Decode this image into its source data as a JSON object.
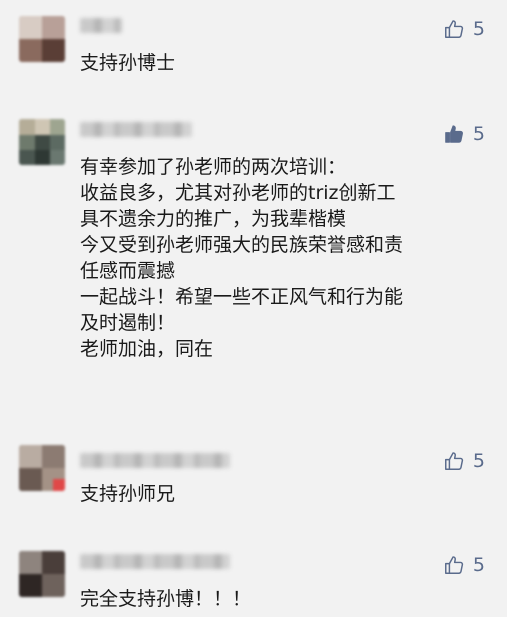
{
  "comments": [
    {
      "author": "",
      "text": "支持孙博士",
      "likes": "5",
      "liked": false
    },
    {
      "author": "",
      "text_lines": [
        "有幸参加了孙老师的两次培训：",
        "收益良多，尤其对孙老师的triz创新工",
        "具不遗余力的推广，为我辈楷模",
        "今又受到孙老师强大的民族荣誉感和责",
        "任感而震撼",
        "一起战斗！希望一些不正风气和行为能",
        "及时遏制！",
        "老师加油，同在"
      ],
      "likes": "5",
      "liked": true
    },
    {
      "author": "",
      "text": "支持孙师兄",
      "likes": "5",
      "liked": false
    },
    {
      "author": "",
      "text": "完全支持孙博！！！",
      "likes": "5",
      "liked": false
    }
  ],
  "icons": {
    "like_outline": "thumbs-up-outline-icon",
    "like_filled": "thumbs-up-filled-icon"
  },
  "colors": {
    "background": "#f2f2f2",
    "like_color": "#5a6b8c",
    "text_color": "#1a1a1a"
  }
}
